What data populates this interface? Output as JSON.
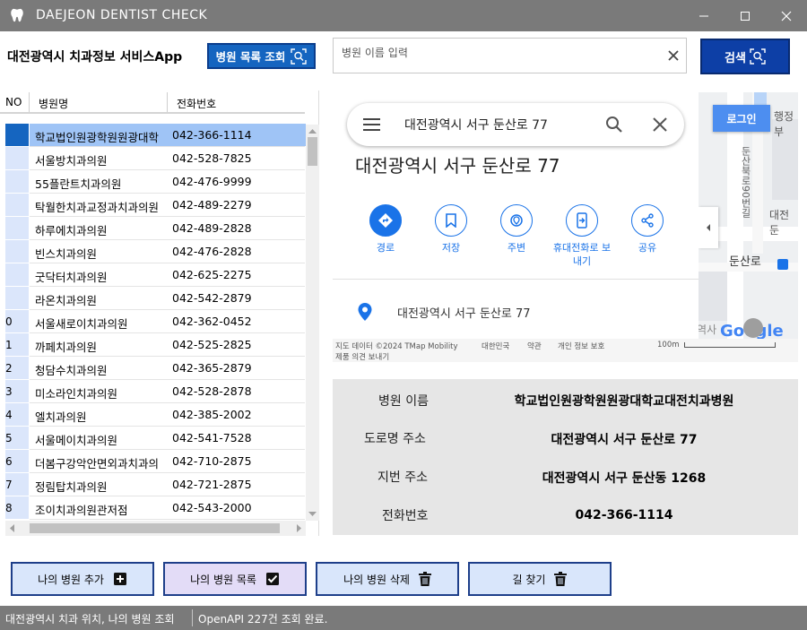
{
  "window": {
    "title": "DAEJEON DENTIST CHECK",
    "controls": [
      "minimize",
      "maximize",
      "close"
    ]
  },
  "header": {
    "app_label": "대전광역시 치과정보 서비스App",
    "list_button": "병원 목록 조회",
    "search_placeholder": "병원 이름 입력",
    "search_button": "검색"
  },
  "grid": {
    "columns": [
      "NO",
      "병원명",
      "전화번호"
    ],
    "rows": [
      {
        "no": "",
        "name": "학교법인원광학원원광대학",
        "phone": "042-366-1114",
        "selected": true
      },
      {
        "no": "",
        "name": "서울방치과의원",
        "phone": "042-528-7825"
      },
      {
        "no": "",
        "name": "55플란트치과의원",
        "phone": "042-476-9999"
      },
      {
        "no": "",
        "name": "탁월한치과교정과치과의원",
        "phone": "042-489-2279"
      },
      {
        "no": "",
        "name": "하루에치과의원",
        "phone": "042-489-2828"
      },
      {
        "no": "",
        "name": "빈스치과의원",
        "phone": "042-476-2828"
      },
      {
        "no": "",
        "name": "굿닥터치과의원",
        "phone": "042-625-2275"
      },
      {
        "no": "",
        "name": "라온치과의원",
        "phone": "042-542-2879"
      },
      {
        "no": "0",
        "name": "서울새로이치과의원",
        "phone": "042-362-0452"
      },
      {
        "no": "1",
        "name": "까페치과의원",
        "phone": "042-525-2825"
      },
      {
        "no": "2",
        "name": "청담수치과의원",
        "phone": "042-365-2879"
      },
      {
        "no": "3",
        "name": "미소라인치과의원",
        "phone": "042-528-2878"
      },
      {
        "no": "4",
        "name": "엘치과의원",
        "phone": "042-385-2002"
      },
      {
        "no": "5",
        "name": "서울메이치과의원",
        "phone": "042-541-7528"
      },
      {
        "no": "6",
        "name": "더봄구강악안면외과치과의",
        "phone": "042-710-2875"
      },
      {
        "no": "7",
        "name": "정림탑치과의원",
        "phone": "042-721-2875"
      },
      {
        "no": "8",
        "name": "조이치과의원관저점",
        "phone": "042-543-2000"
      }
    ]
  },
  "map": {
    "search_text": "대전광역시 서구 둔산로 77",
    "title": "대전광역시 서구 둔산로 77",
    "actions": [
      {
        "icon": "directions-icon",
        "label": "경로"
      },
      {
        "icon": "bookmark-icon",
        "label": "저장"
      },
      {
        "icon": "nearby-icon",
        "label": "주변"
      },
      {
        "icon": "send-to-phone-icon",
        "label": "휴대전화로 보\n내기"
      },
      {
        "icon": "share-icon",
        "label": "공유"
      }
    ],
    "address": "대전광역시 서구 둔산로 77",
    "login": "로그인",
    "footer": {
      "data": "지도 데이터 ©2024 TMap Mobility",
      "country": "대한민국",
      "terms": "약관",
      "privacy": "개인 정보 보호",
      "feedback": "제품 의견 보내기",
      "scale": "100m"
    },
    "labels": {
      "road": "둔산로",
      "road_vertical": "둔산북로90번길",
      "place1": "행정부",
      "place2": "대전둔",
      "place3": "병역사",
      "google": "Google"
    }
  },
  "info": {
    "name_label": "병원 이름",
    "name_value": "학교법인원광학원원광대학교대전치과병원",
    "road_label": "도로명 주소",
    "road_value": "대전광역시 서구 둔산로 77",
    "lot_label": "지번 주소",
    "lot_value": "대전광역시 서구 둔산동 1268",
    "phone_label": "전화번호",
    "phone_value": "042-366-1114"
  },
  "buttons": {
    "add": "나의 병원 추가",
    "list": "나의 병원 목록",
    "delete": "나의 병원 삭제",
    "route": "길 찾기"
  },
  "status": {
    "left": "대전광역시 치과 위치, 나의 병원 조회",
    "right": "OpenAPI 227건 조회 완료."
  },
  "colors": {
    "title_bar": "#7a7a7a",
    "accent": "#1565c0",
    "selected_row": "#9fc4f6",
    "map_blue": "#1a73e8"
  }
}
